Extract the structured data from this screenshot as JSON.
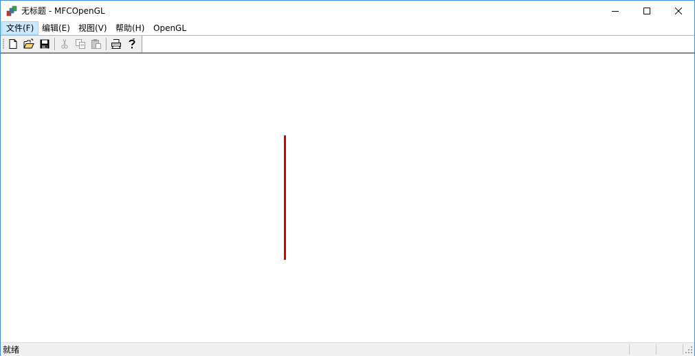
{
  "window": {
    "title": "无标题 - MFCOpenGL"
  },
  "menu": {
    "items": [
      {
        "label": "文件(F)"
      },
      {
        "label": "编辑(E)"
      },
      {
        "label": "视图(V)"
      },
      {
        "label": "帮助(H)"
      },
      {
        "label": "OpenGL"
      }
    ]
  },
  "toolbar": {
    "buttons": [
      {
        "icon": "new-file-icon"
      },
      {
        "icon": "open-folder-icon"
      },
      {
        "icon": "save-icon"
      },
      {
        "icon": "cut-icon"
      },
      {
        "icon": "copy-icon"
      },
      {
        "icon": "paste-icon"
      },
      {
        "icon": "print-icon"
      },
      {
        "icon": "help-icon"
      }
    ]
  },
  "canvas": {
    "line_color": "#d40000"
  },
  "statusbar": {
    "text": "就绪"
  },
  "colors": {
    "accent": "#3c8ad8",
    "menu_highlight": "#cce8ff"
  }
}
